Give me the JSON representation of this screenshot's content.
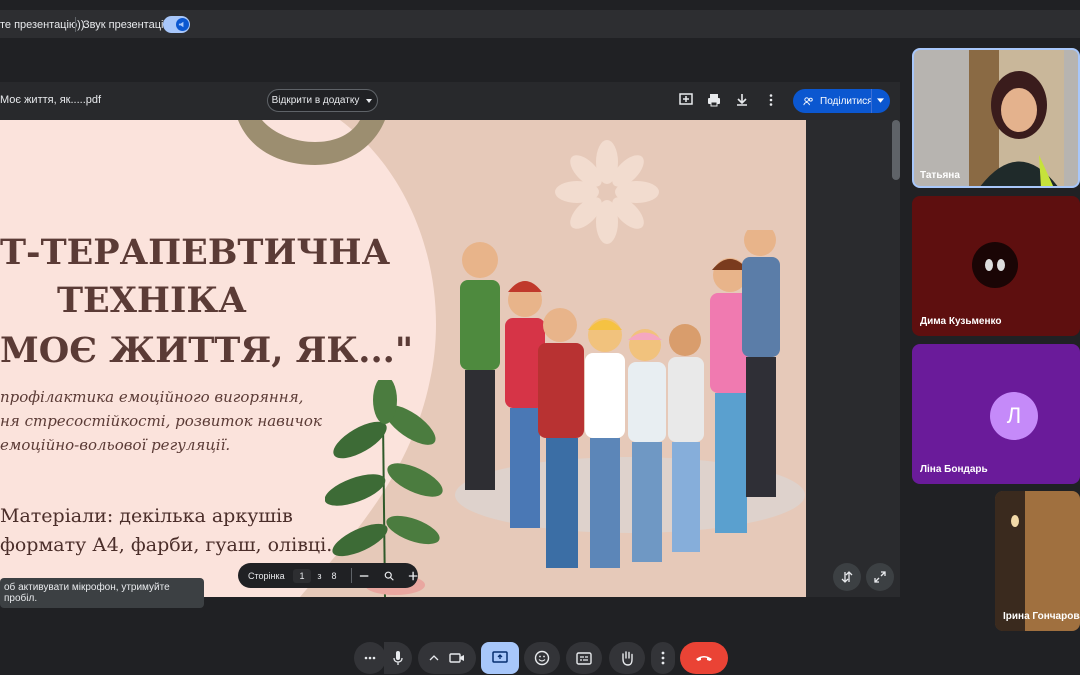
{
  "topbar": {
    "presentation_label": "те презентацію))",
    "sound_label": "Звук презентації"
  },
  "viewer": {
    "filename": "Моє життя, як.....pdf",
    "open_with": "Відкрити в додатку",
    "share": "Поділитися"
  },
  "slide": {
    "title_line1": "Т-ТЕРАПЕВТИЧНА",
    "title_line2": "ТЕХНІКА",
    "title_line3": "МОЄ ЖИТТЯ, ЯК...\"",
    "desc_line1": "профілактика емоційного вигоряння,",
    "desc_line2": "ня стресостійкості, розвиток навичок",
    "desc_line3": "емоційно-вольової регуляції.",
    "materials_line1": "Матеріали: декілька аркушів",
    "materials_line2": "формату А4, фарби, гуаш, олівці."
  },
  "pager": {
    "label": "Сторінка",
    "current": "1",
    "of": "з",
    "total": "8"
  },
  "tooltip": "об активувати мікрофон, утримуйте пробіл.",
  "participants": [
    {
      "name": "Татьяна"
    },
    {
      "name": "Дима Кузьменко"
    },
    {
      "name": "Ліна Бондарь",
      "initial": "Л",
      "color": "#c58af9"
    },
    {
      "name": "Ірина Гончарова"
    }
  ],
  "colors": {
    "accent": "#0b57d0",
    "present_active": "#a8c7fa",
    "end_call": "#ea4335",
    "tile_lina_bg": "#6a1b9a",
    "tile_dima_bg": "#6d0f0f"
  }
}
